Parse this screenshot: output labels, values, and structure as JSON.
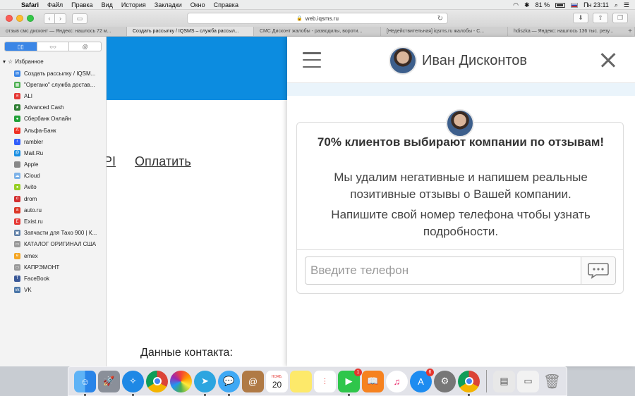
{
  "menubar": {
    "items": [
      "Safari",
      "Файл",
      "Правка",
      "Вид",
      "История",
      "Закладки",
      "Окно",
      "Справка"
    ],
    "battery": "81 %",
    "clock": "Пн 23:11"
  },
  "toolbar": {
    "url": "web.iqsms.ru"
  },
  "tabs": [
    "отзыв смс дисконт — Яндекс: нашлось 72 м...",
    "Создать рассылку / IQSMS – служба рассыл...",
    "СМС Дисконт жалобы - разводилы, вороти...",
    "[Недействительная] iqsms.ru жалобы - С...",
    "hdiszka — Яндекс: нашлось 136 тыс. резу..."
  ],
  "sidebar": {
    "segments": [
      "📖",
      "👓",
      "@"
    ],
    "favorites_label": "Избранное",
    "items": [
      {
        "label": "Создать рассылку / IQSM...",
        "color": "#3b86e6",
        "glyph": "✉"
      },
      {
        "label": "\"Орегано\" служба достав...",
        "color": "#4caf50",
        "glyph": "▦"
      },
      {
        "label": "ALI",
        "color": "#e53935",
        "glyph": "a"
      },
      {
        "label": "Advanced Cash",
        "color": "#2e7d32",
        "glyph": "★"
      },
      {
        "label": "Сбербанк Онлайн",
        "color": "#21a038",
        "glyph": "●"
      },
      {
        "label": "Альфа-Банк",
        "color": "#ef3124",
        "glyph": "A"
      },
      {
        "label": "rambler",
        "color": "#315efb",
        "glyph": "r"
      },
      {
        "label": "Mail.Ru",
        "color": "#168de2",
        "glyph": "@"
      },
      {
        "label": "Apple",
        "color": "#888888",
        "glyph": ""
      },
      {
        "label": "iCloud",
        "color": "#7fb3e8",
        "glyph": "☁"
      },
      {
        "label": "Avito",
        "color": "#97cf26",
        "glyph": "●"
      },
      {
        "label": "drom",
        "color": "#d32f2f",
        "glyph": "d"
      },
      {
        "label": "auto.ru",
        "color": "#db3727",
        "glyph": "a"
      },
      {
        "label": "Exist.ru",
        "color": "#e53935",
        "glyph": "E"
      },
      {
        "label": "Запчасти для Тахо 900 | К...",
        "color": "#5f7fa6",
        "glyph": "▣"
      },
      {
        "label": "КАТАЛОГ ОРИГИНАЛ США",
        "color": "#999999",
        "glyph": "▭"
      },
      {
        "label": "emex",
        "color": "#f5a623",
        "glyph": "e"
      },
      {
        "label": "КАПРЭМОНТ",
        "color": "#999999",
        "glyph": "▭"
      },
      {
        "label": "FaceBook",
        "color": "#3b5998",
        "glyph": "f"
      },
      {
        "label": "VK",
        "color": "#4a76a8",
        "glyph": "vk"
      }
    ]
  },
  "page": {
    "api_fragment": "PI",
    "pay_link": "Оплатить",
    "contact_label": "Данные контакта:"
  },
  "widget": {
    "agent_name": "Иван Дисконтов",
    "headline": "70% клиентов выбирают компании по отзывам!",
    "body1": "Мы удалим негативные и напишем реальные позитивные отзывы о Вашей компании.",
    "body2": "Напишите свой номер телефона чтобы узнать подробности.",
    "phone_placeholder": "Введите телефон"
  },
  "dock": {
    "calendar_month": "НОЯБ.",
    "calendar_day": "20",
    "badge_facetime": "1",
    "badge_appstore": "6"
  }
}
